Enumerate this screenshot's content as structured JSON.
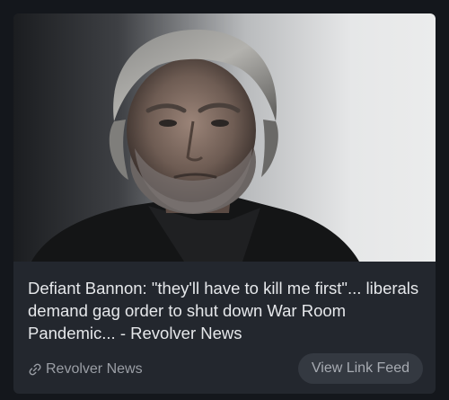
{
  "card": {
    "image_alt": "Portrait of a gray-haired man in a dark jacket",
    "title": "Defiant Bannon: \"they'll have to kill me first\"... liberals demand gag order to shut down War Room Pandemic... - Revolver News",
    "source": "Revolver News",
    "source_icon": "link-icon",
    "feed_button_label": "View Link Feed"
  },
  "colors": {
    "background": "#14171c",
    "card": "#23272e",
    "title_text": "#e6e8eb",
    "muted_text": "#9a9ea5",
    "button_bg": "#343941"
  }
}
